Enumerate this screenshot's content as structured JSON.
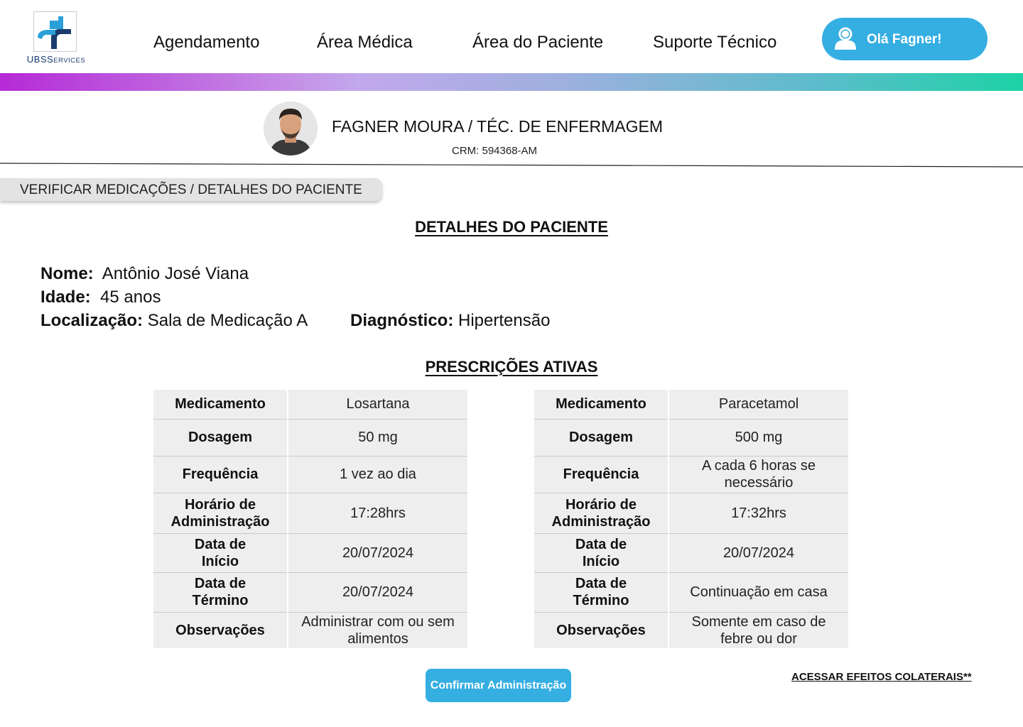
{
  "header": {
    "logo_text_main": "UBS",
    "logo_text_small": "ERVICES",
    "logo_text_cap": "S",
    "nav": [
      "Agendamento",
      "Área Médica",
      "Área do Paciente",
      "Suporte Técnico"
    ],
    "user_greeting": "Olá Fagner!"
  },
  "profile": {
    "name_role": "FAGNER MOURA / TÉC. DE ENFERMAGEM",
    "crm": "CRM: 594368-AM"
  },
  "breadcrumb": "VERIFICAR MEDICAÇÕES / DETALHES DO PACIENTE",
  "patient": {
    "section_title": "DETALHES DO PACIENTE",
    "name_label": "Nome:",
    "name_value": "Antônio José Viana",
    "age_label": "Idade:",
    "age_value": "45 anos",
    "location_label": "Localização:",
    "location_value": "Sala de Medicação A",
    "diagnosis_label": "Diagnóstico:",
    "diagnosis_value": "Hipertensão"
  },
  "prescriptions": {
    "section_title": "PRESCRIÇÕES ATIVAS",
    "labels": {
      "medicamento": "Medicamento",
      "dosagem": "Dosagem",
      "frequencia": "Frequência",
      "horario_1": "Horário de",
      "horario_2": "Administração",
      "inicio_1": "Data de",
      "inicio_2": "Início",
      "termino_1": "Data de",
      "termino_2": "Término",
      "observacoes": "Observações"
    },
    "items": [
      {
        "medicamento": "Losartana",
        "dosagem": "50 mg",
        "frequencia_1": "1 vez ao dia",
        "frequencia_2": "",
        "horario": "17:28hrs",
        "inicio": "20/07/2024",
        "termino": "20/07/2024",
        "observacoes_1": "Administrar com ou sem",
        "observacoes_2": "alimentos"
      },
      {
        "medicamento": "Paracetamol",
        "dosagem": "500 mg",
        "frequencia_1": "A cada 6 horas se",
        "frequencia_2": "necessário",
        "horario": "17:32hrs",
        "inicio": "20/07/2024",
        "termino": "Continuação em casa",
        "observacoes_1": "Somente em caso de",
        "observacoes_2": "febre ou dor"
      }
    ]
  },
  "actions": {
    "confirm": "Confirmar Administração",
    "side_effects": "ACESSAR EFEITOS COLATERAIS**"
  },
  "colors": {
    "accent": "#35aee2",
    "gradient_start": "#b52ad6",
    "gradient_end": "#1dd3a6",
    "table_bg": "#eeeeee"
  }
}
